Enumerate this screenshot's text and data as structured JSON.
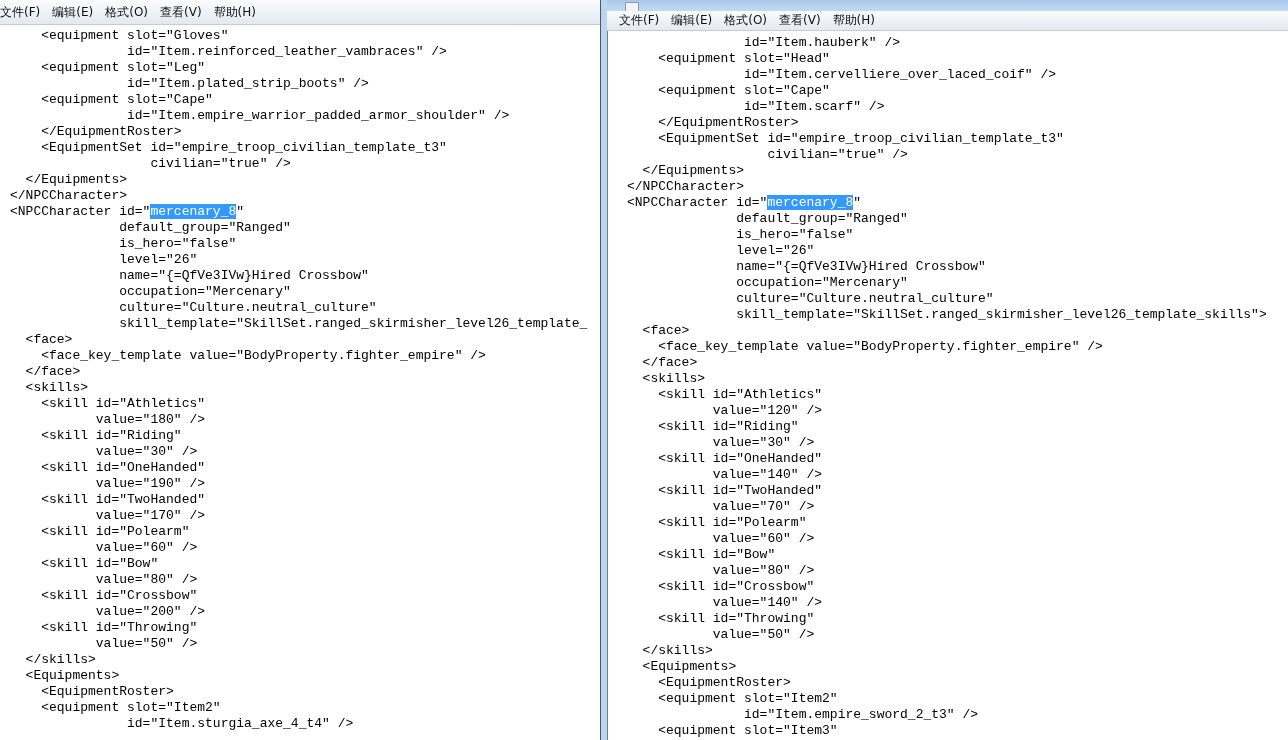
{
  "windows": [
    {
      "title_bar": false,
      "menu": [
        "文件(F)",
        "编辑(E)",
        "格式(O)",
        "查看(V)",
        "帮助(H)"
      ],
      "lines": [
        "    <equipment slot=\"Gloves\"",
        "               id=\"Item.reinforced_leather_vambraces\" />",
        "    <equipment slot=\"Leg\"",
        "               id=\"Item.plated_strip_boots\" />",
        "    <equipment slot=\"Cape\"",
        "               id=\"Item.empire_warrior_padded_armor_shoulder\" />",
        "    </EquipmentRoster>",
        "    <EquipmentSet id=\"empire_troop_civilian_template_t3\"",
        "                  civilian=\"true\" />",
        "  </Equipments>",
        "</NPCCharacter>",
        [
          {
            "text": "<NPCCharacter id=\"",
            "selected": false
          },
          {
            "text": "mercenary_8",
            "selected": true
          },
          {
            "text": "\"",
            "selected": false
          }
        ],
        "              default_group=\"Ranged\"",
        "              is_hero=\"false\"",
        "              level=\"26\"",
        "              name=\"{=QfVe3IVw}Hired Crossbow\"",
        "              occupation=\"Mercenary\"",
        "              culture=\"Culture.neutral_culture\"",
        "              skill_template=\"SkillSet.ranged_skirmisher_level26_template_",
        "  <face>",
        "    <face_key_template value=\"BodyProperty.fighter_empire\" />",
        "  </face>",
        "  <skills>",
        "    <skill id=\"Athletics\"",
        "           value=\"180\" />",
        "    <skill id=\"Riding\"",
        "           value=\"30\" />",
        "    <skill id=\"OneHanded\"",
        "           value=\"190\" />",
        "    <skill id=\"TwoHanded\"",
        "           value=\"170\" />",
        "    <skill id=\"Polearm\"",
        "           value=\"60\" />",
        "    <skill id=\"Bow\"",
        "           value=\"80\" />",
        "    <skill id=\"Crossbow\"",
        "           value=\"200\" />",
        "    <skill id=\"Throwing\"",
        "           value=\"50\" />",
        "  </skills>",
        "  <Equipments>",
        "    <EquipmentRoster>",
        "    <equipment slot=\"Item2\"",
        "               id=\"Item.sturgia_axe_4_t4\" />"
      ]
    },
    {
      "title_bar": true,
      "menu": [
        "文件(F)",
        "编辑(E)",
        "格式(O)",
        "查看(V)",
        "帮助(H)"
      ],
      "lines": [
        "               id=\"Item.hauberk\" />",
        "    <equipment slot=\"Head\"",
        "               id=\"Item.cervelliere_over_laced_coif\" />",
        "    <equipment slot=\"Cape\"",
        "               id=\"Item.scarf\" />",
        "    </EquipmentRoster>",
        "    <EquipmentSet id=\"empire_troop_civilian_template_t3\"",
        "                  civilian=\"true\" />",
        "  </Equipments>",
        "</NPCCharacter>",
        [
          {
            "text": "<NPCCharacter id=\"",
            "selected": false
          },
          {
            "text": "mercenary_8",
            "selected": true
          },
          {
            "text": "\"",
            "selected": false
          }
        ],
        "              default_group=\"Ranged\"",
        "              is_hero=\"false\"",
        "              level=\"26\"",
        "              name=\"{=QfVe3IVw}Hired Crossbow\"",
        "              occupation=\"Mercenary\"",
        "              culture=\"Culture.neutral_culture\"",
        "              skill_template=\"SkillSet.ranged_skirmisher_level26_template_skills\">",
        "  <face>",
        "    <face_key_template value=\"BodyProperty.fighter_empire\" />",
        "  </face>",
        "  <skills>",
        "    <skill id=\"Athletics\"",
        "           value=\"120\" />",
        "    <skill id=\"Riding\"",
        "           value=\"30\" />",
        "    <skill id=\"OneHanded\"",
        "           value=\"140\" />",
        "    <skill id=\"TwoHanded\"",
        "           value=\"70\" />",
        "    <skill id=\"Polearm\"",
        "           value=\"60\" />",
        "    <skill id=\"Bow\"",
        "           value=\"80\" />",
        "    <skill id=\"Crossbow\"",
        "           value=\"140\" />",
        "    <skill id=\"Throwing\"",
        "           value=\"50\" />",
        "  </skills>",
        "  <Equipments>",
        "    <EquipmentRoster>",
        "    <equipment slot=\"Item2\"",
        "               id=\"Item.empire_sword_2_t3\" />",
        "    <equipment slot=\"Item3\""
      ]
    }
  ]
}
